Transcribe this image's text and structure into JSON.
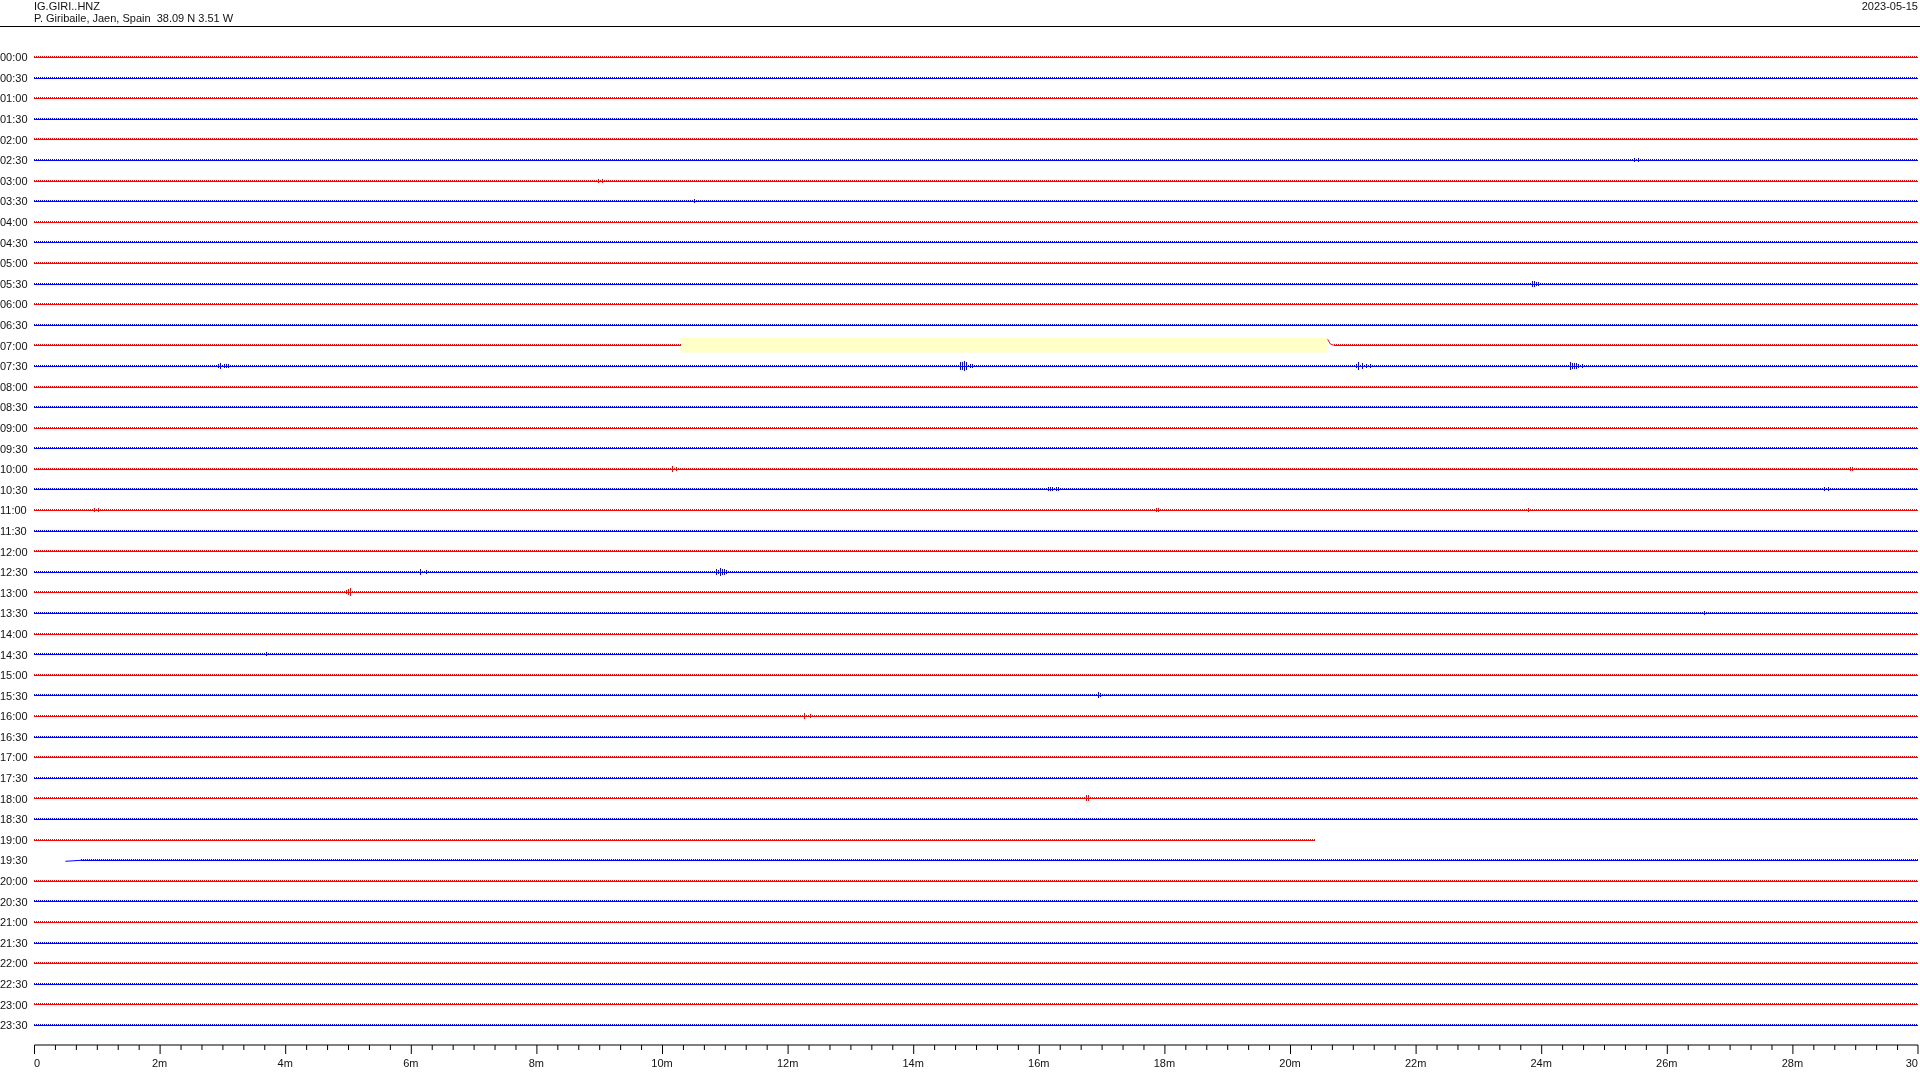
{
  "header": {
    "station": "IG.GIRI..HNZ",
    "location": "P. Giribaile, Jaen, Spain  38.09 N 3.51 W",
    "date": "2023-05-15"
  },
  "rows": [
    {
      "label": "00:00",
      "color": "#ff0000",
      "highlighted": false
    },
    {
      "label": "00:30",
      "color": "#0000ff",
      "highlighted": false
    },
    {
      "label": "01:00",
      "color": "#ff0000",
      "highlighted": false
    },
    {
      "label": "01:30",
      "color": "#0000ff",
      "highlighted": false
    },
    {
      "label": "02:00",
      "color": "#ff0000",
      "highlighted": false
    },
    {
      "label": "02:30",
      "color": "#0000ff",
      "highlighted": false
    },
    {
      "label": "03:00",
      "color": "#ff0000",
      "highlighted": false
    },
    {
      "label": "03:30",
      "color": "#0000ff",
      "highlighted": false
    },
    {
      "label": "04:00",
      "color": "#ff0000",
      "highlighted": false
    },
    {
      "label": "04:30",
      "color": "#0000ff",
      "highlighted": false
    },
    {
      "label": "05:00",
      "color": "#ff0000",
      "highlighted": false
    },
    {
      "label": "05:30",
      "color": "#0000ff",
      "highlighted": false
    },
    {
      "label": "06:00",
      "color": "#ff0000",
      "highlighted": false
    },
    {
      "label": "06:30",
      "color": "#0000ff",
      "highlighted": false
    },
    {
      "label": "07:00",
      "color": "#ff0000",
      "highlighted": true
    },
    {
      "label": "07:30",
      "color": "#0000ff",
      "highlighted": false
    },
    {
      "label": "08:00",
      "color": "#ff0000",
      "highlighted": false
    },
    {
      "label": "08:30",
      "color": "#0000ff",
      "highlighted": false
    },
    {
      "label": "09:00",
      "color": "#ff0000",
      "highlighted": false
    },
    {
      "label": "09:30",
      "color": "#0000ff",
      "highlighted": false
    },
    {
      "label": "10:00",
      "color": "#ff0000",
      "highlighted": false
    },
    {
      "label": "10:30",
      "color": "#0000ff",
      "highlighted": false
    },
    {
      "label": "11:00",
      "color": "#ff0000",
      "highlighted": false
    },
    {
      "label": "11:30",
      "color": "#0000ff",
      "highlighted": false
    },
    {
      "label": "12:00",
      "color": "#ff0000",
      "highlighted": false
    },
    {
      "label": "12:30",
      "color": "#0000ff",
      "highlighted": false
    },
    {
      "label": "13:00",
      "color": "#ff0000",
      "highlighted": false
    },
    {
      "label": "13:30",
      "color": "#0000ff",
      "highlighted": false
    },
    {
      "label": "14:00",
      "color": "#ff0000",
      "highlighted": false
    },
    {
      "label": "14:30",
      "color": "#0000ff",
      "highlighted": false
    },
    {
      "label": "15:00",
      "color": "#ff0000",
      "highlighted": false
    },
    {
      "label": "15:30",
      "color": "#0000ff",
      "highlighted": false
    },
    {
      "label": "16:00",
      "color": "#ff0000",
      "highlighted": false
    },
    {
      "label": "16:30",
      "color": "#0000ff",
      "highlighted": false
    },
    {
      "label": "17:00",
      "color": "#ff0000",
      "highlighted": false
    },
    {
      "label": "17:30",
      "color": "#0000ff",
      "highlighted": false
    },
    {
      "label": "18:00",
      "color": "#ff0000",
      "highlighted": false
    },
    {
      "label": "18:30",
      "color": "#0000ff",
      "highlighted": false
    },
    {
      "label": "19:00",
      "color": "#ff0000",
      "highlighted": false,
      "level": 0.68
    },
    {
      "label": "19:30",
      "color": "#0000ff",
      "highlighted": false
    },
    {
      "label": "20:00",
      "color": "#ff0000",
      "highlighted": false
    },
    {
      "label": "20:30",
      "color": "#0000ff",
      "highlighted": false
    },
    {
      "label": "21:00",
      "color": "#ff0000",
      "highlighted": false
    },
    {
      "label": "21:30",
      "color": "#0000ff",
      "highlighted": false
    },
    {
      "label": "22:00",
      "color": "#ff0000",
      "highlighted": false
    },
    {
      "label": "22:30",
      "color": "#0000ff",
      "highlighted": false
    },
    {
      "label": "23:00",
      "color": "#ff0000",
      "highlighted": false
    },
    {
      "label": "23:30",
      "color": "#0000ff",
      "highlighted": false
    }
  ],
  "x_axis": {
    "ticks": [
      "0",
      "2m",
      "4m",
      "6m",
      "8m",
      "10m",
      "12m",
      "14m",
      "16m",
      "18m",
      "20m",
      "22m",
      "24m",
      "26m",
      "28m",
      "30"
    ]
  }
}
